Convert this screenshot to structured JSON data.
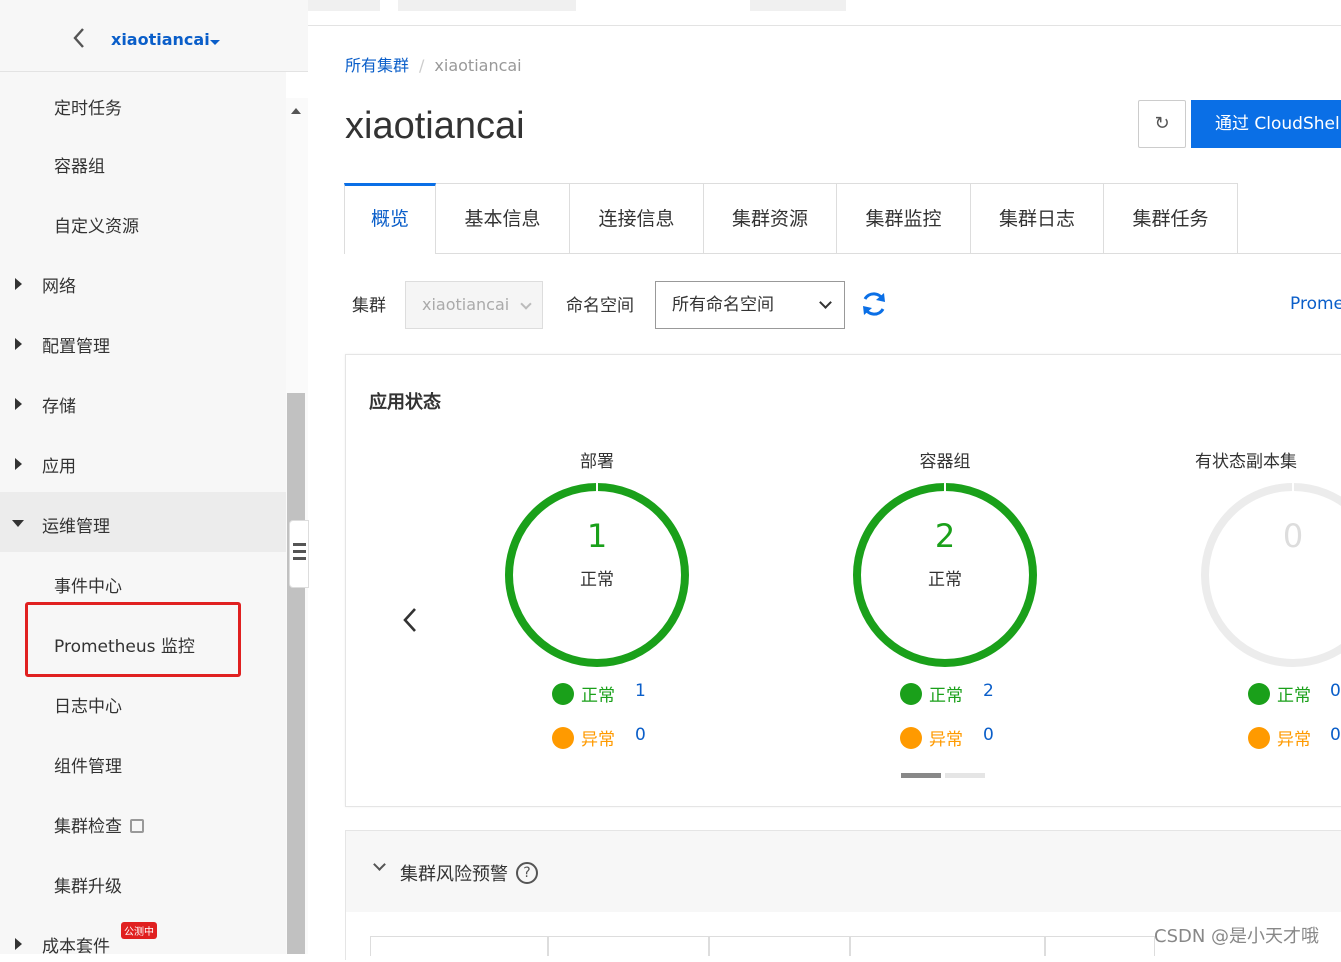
{
  "sidebar": {
    "cluster_name": "xiaotiancai",
    "items": [
      {
        "label": "定时任务",
        "type": "sub"
      },
      {
        "label": "容器组",
        "type": "sub"
      },
      {
        "label": "自定义资源",
        "type": "sub"
      },
      {
        "label": "网络",
        "type": "group"
      },
      {
        "label": "配置管理",
        "type": "group"
      },
      {
        "label": "存储",
        "type": "group"
      },
      {
        "label": "应用",
        "type": "group"
      },
      {
        "label": "运维管理",
        "type": "group-open"
      },
      {
        "label": "事件中心",
        "type": "sub"
      },
      {
        "label": "Prometheus 监控",
        "type": "sub"
      },
      {
        "label": "日志中心",
        "type": "sub"
      },
      {
        "label": "组件管理",
        "type": "sub"
      },
      {
        "label": "集群检查",
        "type": "sub"
      },
      {
        "label": "集群升级",
        "type": "sub"
      },
      {
        "label": "成本套件",
        "type": "group"
      }
    ],
    "beta_badge": "公测中"
  },
  "breadcrumb": {
    "root": "所有集群",
    "separator": "/",
    "current": "xiaotiancai"
  },
  "page_title": "xiaotiancai",
  "buttons": {
    "refresh_glyph": "↻",
    "cloudshell": "通过 CloudShell"
  },
  "tabs": [
    "概览",
    "基本信息",
    "连接信息",
    "集群资源",
    "集群监控",
    "集群日志",
    "集群任务"
  ],
  "filters": {
    "cluster_label": "集群",
    "cluster_value": "xiaotiancai",
    "namespace_label": "命名空间",
    "namespace_value": "所有命名空间",
    "prometheus_link": "Prome"
  },
  "app_status": {
    "title": "应用状态",
    "cards": [
      {
        "title": "部署",
        "count": "1",
        "status": "正常",
        "normal_label": "正常",
        "normal": "1",
        "abnormal_label": "异常",
        "abnormal": "0"
      },
      {
        "title": "容器组",
        "count": "2",
        "status": "正常",
        "normal_label": "正常",
        "normal": "2",
        "abnormal_label": "异常",
        "abnormal": "0"
      },
      {
        "title": "有状态副本集",
        "count": "0",
        "status": "",
        "normal_label": "正常",
        "normal": "0",
        "abnormal_label": "异常",
        "abnormal": "0"
      }
    ]
  },
  "risk": {
    "title": "集群风险预警",
    "help_glyph": "?"
  },
  "watermark": "CSDN @是小天才哦",
  "colors": {
    "accent": "#0a6fe6",
    "ok": "#1aa01a",
    "warn": "#ff9a00",
    "highlight": "#e02020"
  }
}
